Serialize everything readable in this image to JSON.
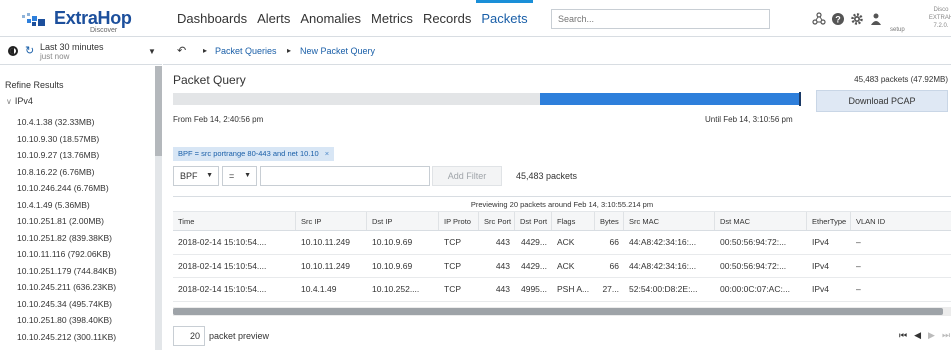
{
  "app": {
    "logo_text": "ExtraHop",
    "logo_sub": "Discover",
    "corner_text_1": "Disco",
    "corner_text_2": "EXTRAH",
    "corner_text_3": "7.2.0.",
    "setup_label": "setup",
    "brand_color": "#1c4f9c",
    "accent_color": "#1a8fd8"
  },
  "nav": {
    "items": [
      {
        "label": "Dashboards"
      },
      {
        "label": "Alerts"
      },
      {
        "label": "Anomalies"
      },
      {
        "label": "Metrics"
      },
      {
        "label": "Records"
      },
      {
        "label": "Packets",
        "active": true
      }
    ],
    "search_placeholder": "Search...",
    "icons": [
      "network-icon",
      "help-icon",
      "gear-icon",
      "user-icon"
    ]
  },
  "time": {
    "main": "Last 30 minutes",
    "sub": "just now"
  },
  "breadcrumb": {
    "items": [
      "Packet Queries",
      "New Packet Query"
    ]
  },
  "sidebar": {
    "refine_title": "Refine Results",
    "group_label": "IPv4",
    "items": [
      "10.4.1.38 (32.33MB)",
      "10.10.9.30 (18.57MB)",
      "10.10.9.27 (13.76MB)",
      "10.8.16.22 (6.76MB)",
      "10.10.246.244 (6.76MB)",
      "10.4.1.49 (5.36MB)",
      "10.10.251.81 (2.00MB)",
      "10.10.251.82 (839.38KB)",
      "10.10.11.116 (792.06KB)",
      "10.10.251.179 (744.84KB)",
      "10.10.245.211 (636.23KB)",
      "10.10.245.34 (495.74KB)",
      "10.10.251.80 (398.40KB)",
      "10.10.245.212 (300.11KB)"
    ]
  },
  "query": {
    "title": "Packet Query",
    "packet_summary": "45,483 packets (47.92MB)",
    "download_label": "Download PCAP",
    "from_label": "From Feb 14, 2:40:56 pm",
    "until_label": "Until Feb 14, 3:10:56 pm",
    "timeline_selected_start_pct": 58.5,
    "timeline_selected_end_pct": 100
  },
  "filter": {
    "chip_label": "BPF = src portrange 80-443 and net 10.10",
    "chip_close": "×",
    "type_select": "BPF",
    "operator_select": "=",
    "value": "",
    "add_filter_label": "Add Filter",
    "count_label": "45,483 packets"
  },
  "table": {
    "preview_caption": "Previewing 20 packets around Feb 14, 3:10:55.214 pm",
    "columns": [
      "Time",
      "Src IP",
      "Dst IP",
      "IP Proto",
      "Src Port",
      "Dst Port",
      "Flags",
      "Bytes",
      "Src MAC",
      "Dst MAC",
      "EtherType",
      "VLAN ID"
    ],
    "rows": [
      [
        "2018-02-14 15:10:54....",
        "10.10.11.249",
        "10.10.9.69",
        "TCP",
        "443",
        "4429...",
        "ACK",
        "66",
        "44:A8:42:34:16:...",
        "00:50:56:94:72:...",
        "IPv4",
        "–"
      ],
      [
        "2018-02-14 15:10:54....",
        "10.10.11.249",
        "10.10.9.69",
        "TCP",
        "443",
        "4429...",
        "ACK",
        "66",
        "44:A8:42:34:16:...",
        "00:50:56:94:72:...",
        "IPv4",
        "–"
      ],
      [
        "2018-02-14 15:10:54....",
        "10.4.1.49",
        "10.10.252....",
        "TCP",
        "443",
        "4995...",
        "PSH A...",
        "27...",
        "52:54:00:D8:2E:...",
        "00:00:0C:07:AC:...",
        "IPv4",
        "–"
      ]
    ]
  },
  "footer": {
    "preview_count": "20",
    "preview_label": "packet preview"
  }
}
